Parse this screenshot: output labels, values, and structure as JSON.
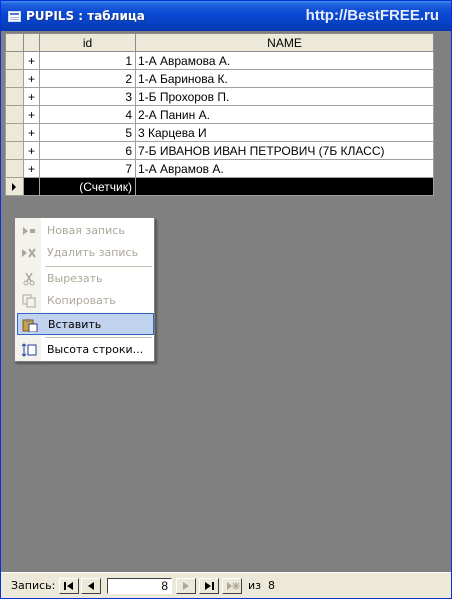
{
  "window": {
    "title": "PUPILS : таблица",
    "watermark": "http://BestFREE.ru"
  },
  "table": {
    "columns": [
      "id",
      "NAME"
    ],
    "rows": [
      {
        "id": "1",
        "name": "1-А Аврамова А."
      },
      {
        "id": "2",
        "name": "1-А Баринова К."
      },
      {
        "id": "3",
        "name": "1-Б Прохоров П."
      },
      {
        "id": "4",
        "name": "2-А Панин А."
      },
      {
        "id": "5",
        "name": "3 Карцева И"
      },
      {
        "id": "6",
        "name": "7-Б ИВАНОВ ИВАН ПЕТРОВИЧ (7Б КЛАСС)"
      },
      {
        "id": "7",
        "name": "1-А Аврамов А."
      }
    ],
    "new_row_counter": "(Счетчик)",
    "expand_glyph": "+"
  },
  "context_menu": {
    "items": [
      {
        "label": "Новая запись",
        "icon": "new-record-icon",
        "enabled": false
      },
      {
        "label": "Удалить запись",
        "icon": "delete-record-icon",
        "enabled": false
      },
      {
        "label": "Вырезать",
        "icon": "scissors-icon",
        "enabled": false
      },
      {
        "label": "Копировать",
        "icon": "copy-icon",
        "enabled": false
      },
      {
        "label": "Вставить",
        "icon": "paste-icon",
        "enabled": true,
        "highlighted": true
      },
      {
        "label": "Высота строки...",
        "icon": "row-height-icon",
        "enabled": true
      }
    ]
  },
  "statusbar": {
    "record_label": "Запись:",
    "current_record": "8",
    "of_label": "из",
    "total_records": "8"
  },
  "colors": {
    "titlebar": "#0a49d4",
    "chrome": "#ece9d8",
    "highlight": "#c1d2ee",
    "highlight_border": "#316ac5"
  }
}
